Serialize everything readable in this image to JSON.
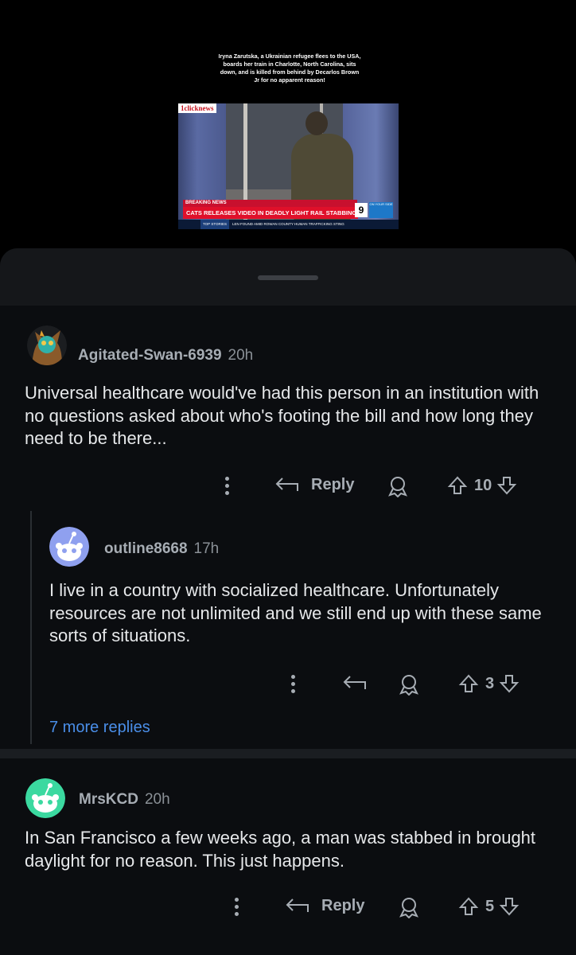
{
  "video": {
    "caption": "Iryna Zarutska, a Ukrainian refugee flees to the USA, boards her train in Charlotte, North Carolina, sits down, and is killed from behind by Decarlos Brown Jr for no apparent reason!",
    "watermark": "1clicknews",
    "breaking_label": "BREAKING NEWS",
    "headline": "CATS RELEASES VIDEO IN DEADLY LIGHT RAIL STABBING",
    "ticker_label": "TOP STORIES",
    "ticker_text": "LEN FOUND AMID ROWAN COUNTY HUMAN TRAFFICKING STING",
    "station_logo": "9",
    "weather_text": "ON YOUR SIDE"
  },
  "comments": [
    {
      "username": "Agitated-Swan-6939",
      "time": "20h",
      "text": "Universal healthcare would've had this person in an institution with no questions asked about who's footing the bill and how long they need to be there...",
      "reply_label": "Reply",
      "votes": "10"
    },
    {
      "username": "outline8668",
      "time": "17h",
      "text": "I live in a country with socialized healthcare. Unfortunately resources are not unlimited and we still end up with these same sorts of situations.",
      "votes": "3"
    },
    {
      "username": "MrsKCD",
      "time": "20h",
      "text": "In San Francisco a few weeks ago, a man was stabbed in brought daylight for no reason. This just happens.",
      "reply_label": "Reply",
      "votes": "5"
    }
  ],
  "more_replies": "7 more replies",
  "colors": {
    "background": "#0b0d10",
    "link": "#4a8ee8",
    "accent_red": "#e0102a"
  },
  "icons": [
    "overflow-dots-icon",
    "reply-arrow-icon",
    "award-icon",
    "upvote-icon",
    "downvote-icon",
    "snoo-avatar-icon"
  ]
}
